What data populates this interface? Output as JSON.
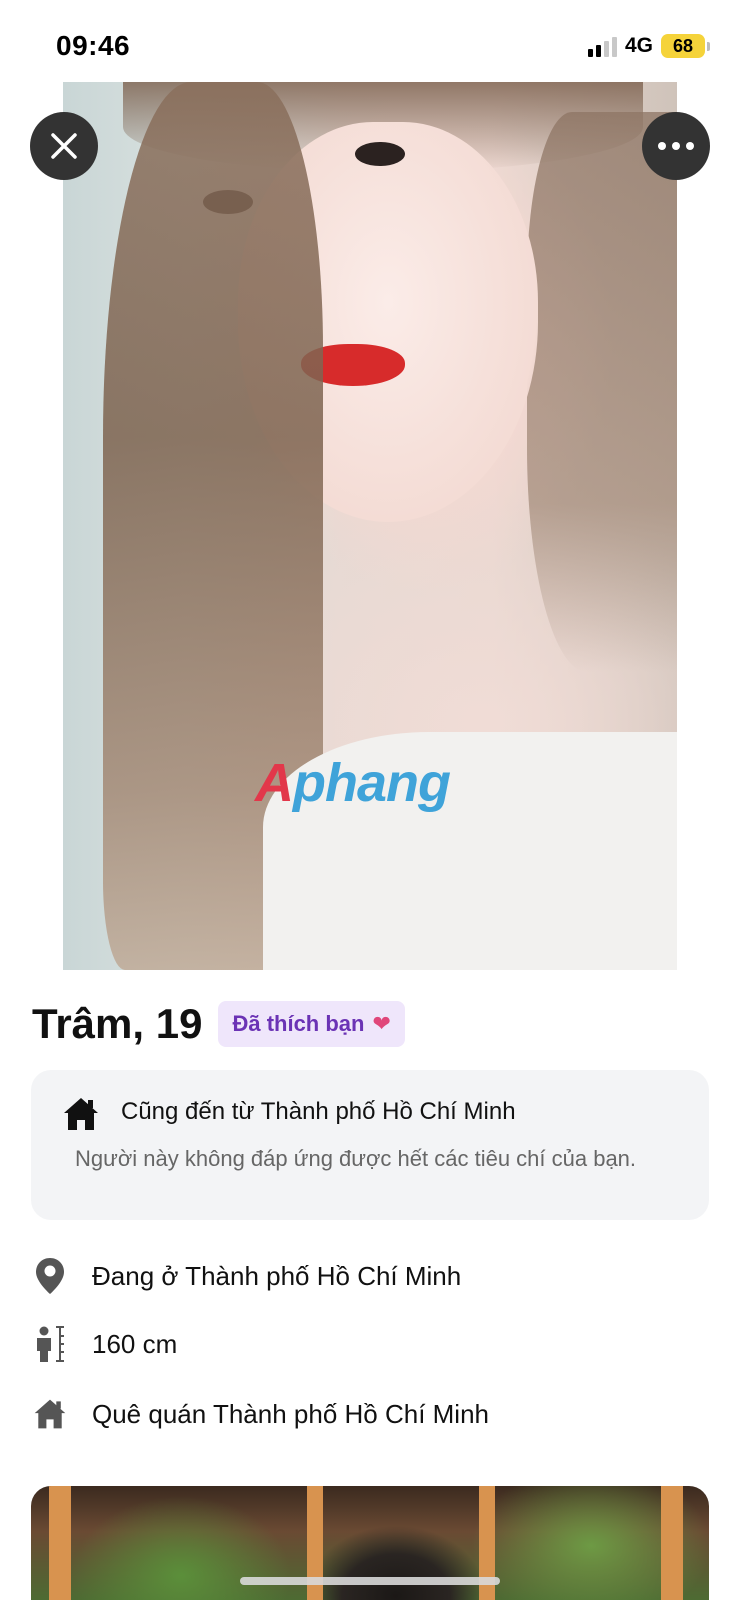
{
  "status_bar": {
    "time": "09:46",
    "network": "4G",
    "battery": "68"
  },
  "photo": {
    "watermark": "Aphang"
  },
  "profile": {
    "name_age": "Trâm, 19",
    "liked_badge": "Đã thích bạn",
    "liked_badge_icon": "heart-icon"
  },
  "hometown_card": {
    "icon": "home-icon",
    "title": "Cũng đến từ Thành phố Hồ Chí Minh",
    "description": "Người này không đáp ứng được hết các tiêu chí của bạn."
  },
  "details": [
    {
      "icon": "location-pin-icon",
      "text": "Đang ở Thành phố Hồ Chí Minh"
    },
    {
      "icon": "height-icon",
      "text": "160 cm"
    },
    {
      "icon": "home-icon",
      "text": "Quê quán Thành phố Hồ Chí Minh"
    }
  ],
  "colors": {
    "badge_bg": "#efe6fb",
    "badge_text": "#6b33b5",
    "card_bg": "#f3f4f6",
    "battery": "#f5d33a"
  }
}
